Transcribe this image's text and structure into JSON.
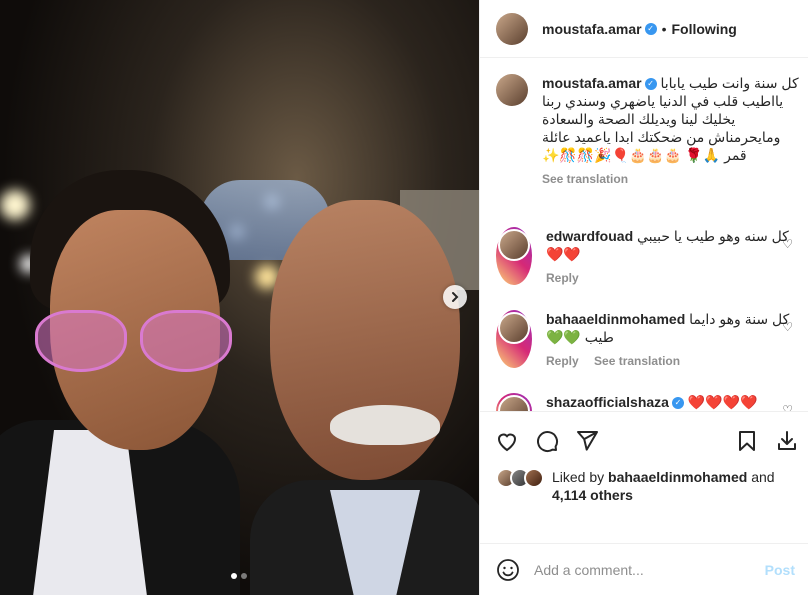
{
  "post": {
    "author": "moustafa.amar",
    "following": "Following",
    "separator": "•",
    "photo_alt": "Selfie of two men at a night event",
    "dots_count": 2,
    "active_dot": 0
  },
  "caption": {
    "username": "moustafa.amar",
    "text": "كل سنة وانت طيب يابابا يااطيب قلب في الدنيا ياضهري وسندي ربنا يخليك لينا ويديلك الصحة والسعادة ومايحرمناش من ضحكتك ابدا ياعميد عائلة قمر 🙏🌹 🎂🎂🎂🎈🎉🎊🎊✨",
    "see_translation": "See translation"
  },
  "comments": [
    {
      "username": "edwardfouad",
      "text": "كل سنه وهو طيب يا حبيبي ❤️❤️",
      "reply": "Reply"
    },
    {
      "username": "bahaaeldinmohamed",
      "text": "كل سنة وهو دايما طيب 💚💚",
      "reply": "Reply",
      "see_translation": "See translation"
    },
    {
      "username": "shazaofficialshaza",
      "text": "❤️❤️❤️❤️"
    }
  ],
  "likes": {
    "prefix": "Liked by",
    "user": "bahaaeldinmohamed",
    "and": "and",
    "count": "4,114 others"
  },
  "add_comment": {
    "placeholder": "Add a comment...",
    "post": "Post"
  },
  "colors": {
    "verified": "#3897f0",
    "post_button": "#b2dffc",
    "heart_red": "#ed4956",
    "heart_green": "#2ecc40"
  }
}
